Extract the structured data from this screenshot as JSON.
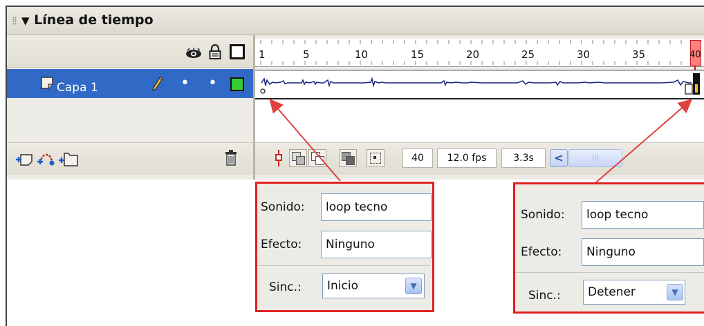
{
  "panel": {
    "title": "Línea de tiempo",
    "collapse_glyph": "▼",
    "header_icons": [
      "eye-icon",
      "lock-icon",
      "outline-square-icon"
    ]
  },
  "layer": {
    "name": "Capa 1",
    "icons": [
      "layer-page-icon",
      "pencil-icon",
      "visibility-dot",
      "lock-dot",
      "outline-color-square"
    ],
    "outline_color": "#33cc33",
    "dot_glyph": "•"
  },
  "ruler": {
    "labels": [
      "1",
      "5",
      "10",
      "15",
      "20",
      "25",
      "30",
      "35",
      "40"
    ],
    "current_frame_label": "40"
  },
  "timeline_footer": {
    "left_icons": [
      "insert-layer-icon",
      "add-motion-guide-icon",
      "insert-folder-icon",
      "trash-icon"
    ],
    "right_icons": [
      "center-frame-icon",
      "onion-skin-icon",
      "onion-skin-outlines-icon",
      "edit-multiple-frames-icon",
      "modify-markers-icon"
    ],
    "current_frame": "40",
    "frame_rate": "12.0 fps",
    "elapsed_time": "3.3s",
    "scroll_left_glyph": "<",
    "scroll_thumb_glyph": "|||"
  },
  "callouts": [
    {
      "sound_label": "Sonido:",
      "sound_value": "loop tecno",
      "effect_label": "Efecto:",
      "effect_value": "Ninguno",
      "sync_label": "Sinc.:",
      "sync_value": "Inicio"
    },
    {
      "sound_label": "Sonido:",
      "sound_value": "loop tecno",
      "effect_label": "Efecto:",
      "effect_value": "Ninguno",
      "sync_label": "Sinc.:",
      "sync_value": "Detener"
    }
  ],
  "colors": {
    "layer_selected_bg": "#3169c6",
    "callout_border": "#e02020",
    "arrow": "#e04040",
    "playhead": "#cc1111",
    "waveform": "#1a237e"
  }
}
